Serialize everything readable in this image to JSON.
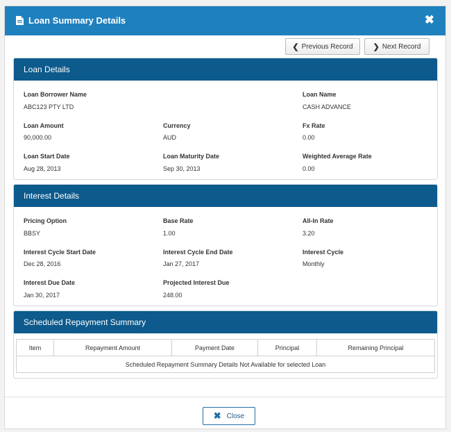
{
  "modal": {
    "title": "Loan Summary Details",
    "close_icon_glyph": "✖",
    "doc_icon": "document-icon"
  },
  "nav": {
    "previous_label": "Previous Record",
    "next_label": "Next Record"
  },
  "loan_details": {
    "heading": "Loan Details",
    "borrower_label": "Loan Borrower Name",
    "borrower_value": "ABC123 PTY LTD",
    "loan_name_label": "Loan Name",
    "loan_name_value": "CASH ADVANCE",
    "amount_label": "Loan Amount",
    "amount_value": "90,000.00",
    "currency_label": "Currency",
    "currency_value": "AUD",
    "fx_label": "Fx Rate",
    "fx_value": "0.00",
    "start_label": "Loan Start Date",
    "start_value": "Aug 28, 2013",
    "maturity_label": "Loan Maturity Date",
    "maturity_value": "Sep 30, 2013",
    "war_label": "Weighted Average Rate",
    "war_value": "0.00"
  },
  "interest_details": {
    "heading": "Interest Details",
    "pricing_label": "Pricing Option",
    "pricing_value": "BBSY",
    "base_label": "Base Rate",
    "base_value": "1.00",
    "allin_label": "All-In Rate",
    "allin_value": "3.20",
    "cycle_start_label": "Interest Cycle Start Date",
    "cycle_start_value": "Dec 28, 2016",
    "cycle_end_label": "Interest Cycle End Date",
    "cycle_end_value": "Jan 27, 2017",
    "cycle_label": "Interest Cycle",
    "cycle_value": "Monthly",
    "due_label": "Interest Due Date",
    "due_value": "Jan 30, 2017",
    "projected_label": "Projected Interest Due",
    "projected_value": "248.00"
  },
  "repayment": {
    "heading": "Scheduled Repayment Summary",
    "columns": [
      "Item",
      "Repayment Amount",
      "Payment Date",
      "Principal",
      "Remaining Principal"
    ],
    "empty_message": "Scheduled Repayment Summary Details Not Available for selected Loan"
  },
  "footer": {
    "close_label": "Close"
  },
  "colors": {
    "header_blue": "#1f80be",
    "panel_blue": "#0d5a8c"
  }
}
